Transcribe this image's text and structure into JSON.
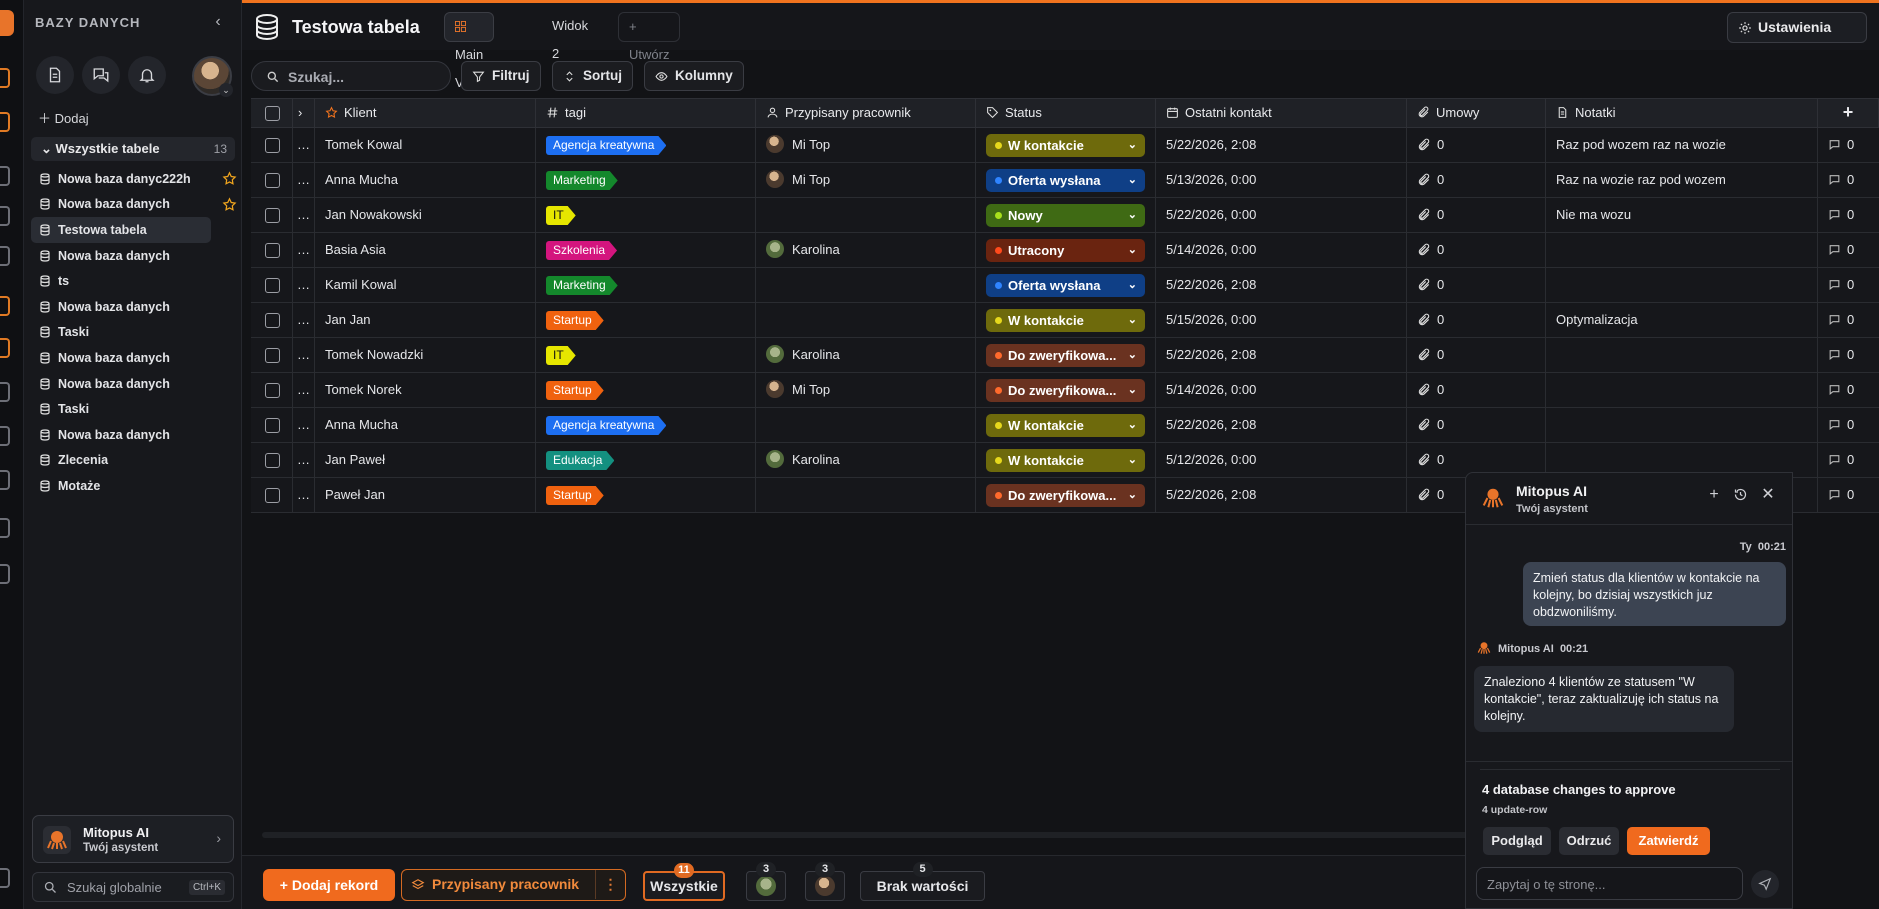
{
  "sidebar": {
    "title": "BAZY DANYCH",
    "add_label": "Dodaj",
    "all_tables_label": "Wszystkie tabele",
    "all_tables_count": "13",
    "tables": [
      {
        "label": "Nowa baza danyc222h",
        "starred": true,
        "active": false
      },
      {
        "label": "Nowa baza danych",
        "starred": true,
        "active": false
      },
      {
        "label": "Testowa tabela",
        "starred": false,
        "active": true
      },
      {
        "label": "Nowa baza danych",
        "starred": false,
        "active": false
      },
      {
        "label": "ts",
        "starred": false,
        "active": false
      },
      {
        "label": "Nowa baza danych",
        "starred": false,
        "active": false
      },
      {
        "label": "Taski",
        "starred": false,
        "active": false
      },
      {
        "label": "Nowa baza danych",
        "starred": false,
        "active": false
      },
      {
        "label": "Nowa baza danych",
        "starred": false,
        "active": false
      },
      {
        "label": "Taski",
        "starred": false,
        "active": false
      },
      {
        "label": "Nowa baza danych",
        "starred": false,
        "active": false
      },
      {
        "label": "Zlecenia",
        "starred": false,
        "active": false
      },
      {
        "label": "Motaże",
        "starred": false,
        "active": false
      }
    ],
    "ai_card": {
      "title": "Mitopus AI",
      "subtitle": "Twój asystent"
    },
    "global_search": {
      "placeholder": "Szukaj globalnie",
      "shortcut": "Ctrl+K"
    }
  },
  "topbar": {
    "title": "Testowa tabela",
    "views": [
      "Main View",
      "Widok 2"
    ],
    "create_label": "+ Utwórz",
    "settings_label": "Ustawienia"
  },
  "toolbar": {
    "search_placeholder": "Szukaj...",
    "filter_label": "Filtruj",
    "sort_label": "Sortuj",
    "columns_label": "Kolumny"
  },
  "table": {
    "columns": [
      "Klient",
      "tagi",
      "Przypisany pracownik",
      "Status",
      "Ostatni kontakt",
      "Umowy",
      "Notatki"
    ],
    "rows": [
      {
        "client": "Tomek Kowal",
        "tag": "Agencja kreatywna",
        "tag_color": "#1d6ff2",
        "worker": "Mi Top",
        "worker_type": "mitop",
        "status": "W kontakcie",
        "status_key": "kontakt",
        "date": "5/22/2026, 2:08",
        "contracts": "0",
        "notes": "Raz pod wozem raz na wozie",
        "comments": "0"
      },
      {
        "client": "Anna Mucha",
        "tag": "Marketing",
        "tag_color": "#14882c",
        "worker": "Mi Top",
        "worker_type": "mitop",
        "status": "Oferta wysłana",
        "status_key": "oferta",
        "date": "5/13/2026, 0:00",
        "contracts": "0",
        "notes": "Raz na wozie raz pod wozem",
        "comments": "0"
      },
      {
        "client": "Jan Nowakowski",
        "tag": "IT",
        "tag_color": "#e6e600",
        "tag_text": "#111111",
        "worker": "",
        "worker_type": "",
        "status": "Nowy",
        "status_key": "nowy",
        "date": "5/22/2026, 0:00",
        "contracts": "0",
        "notes": "Nie ma wozu",
        "comments": "0"
      },
      {
        "client": "Basia Asia",
        "tag": "Szkolenia",
        "tag_color": "#d4157e",
        "worker": "Karolina",
        "worker_type": "karolina",
        "status": "Utracony",
        "status_key": "utracony",
        "date": "5/14/2026, 0:00",
        "contracts": "0",
        "notes": "",
        "comments": "0"
      },
      {
        "client": "Kamil Kowal",
        "tag": "Marketing",
        "tag_color": "#14882c",
        "worker": "",
        "worker_type": "",
        "status": "Oferta wysłana",
        "status_key": "oferta",
        "date": "5/22/2026, 2:08",
        "contracts": "0",
        "notes": "",
        "comments": "0"
      },
      {
        "client": "Jan Jan",
        "tag": "Startup",
        "tag_color": "#f0620f",
        "worker": "",
        "worker_type": "",
        "status": "W kontakcie",
        "status_key": "kontakt",
        "date": "5/15/2026, 0:00",
        "contracts": "0",
        "notes": "Optymalizacja",
        "comments": "0"
      },
      {
        "client": "Tomek Nowadzki",
        "tag": "IT",
        "tag_color": "#e6e600",
        "tag_text": "#111111",
        "worker": "Karolina",
        "worker_type": "karolina",
        "status": "Do zweryfikowa...",
        "status_key": "zweryf",
        "date": "5/22/2026, 2:08",
        "contracts": "0",
        "notes": "",
        "comments": "0"
      },
      {
        "client": "Tomek Norek",
        "tag": "Startup",
        "tag_color": "#f0620f",
        "worker": "Mi Top",
        "worker_type": "mitop",
        "status": "Do zweryfikowa...",
        "status_key": "zweryf",
        "date": "5/14/2026, 0:00",
        "contracts": "0",
        "notes": "",
        "comments": "0"
      },
      {
        "client": "Anna Mucha",
        "tag": "Agencja kreatywna",
        "tag_color": "#1d6ff2",
        "worker": "",
        "worker_type": "",
        "status": "W kontakcie",
        "status_key": "kontakt",
        "date": "5/22/2026, 2:08",
        "contracts": "0",
        "notes": "",
        "comments": "0"
      },
      {
        "client": "Jan Paweł",
        "tag": "Edukacja",
        "tag_color": "#149080",
        "worker": "Karolina",
        "worker_type": "karolina",
        "status": "W kontakcie",
        "status_key": "kontakt",
        "date": "5/12/2026, 0:00",
        "contracts": "0",
        "notes": "",
        "comments": "0"
      },
      {
        "client": "Paweł Jan",
        "tag": "Startup",
        "tag_color": "#f0620f",
        "worker": "",
        "worker_type": "",
        "status": "Do zweryfikowa...",
        "status_key": "zweryf",
        "date": "5/22/2026, 2:08",
        "contracts": "0",
        "notes": "",
        "comments": "0"
      }
    ]
  },
  "status_styles": {
    "kontakt": {
      "bg": "#6e6a0c",
      "dot": "#e6d81c"
    },
    "oferta": {
      "bg": "#0f3f86",
      "dot": "#2f84ff"
    },
    "nowy": {
      "bg": "#3f6a14",
      "dot": "#a8e01c"
    },
    "utracony": {
      "bg": "#6a2410",
      "dot": "#ff4a1c"
    },
    "zweryf": {
      "bg": "#6a3220",
      "dot": "#ff6a2c"
    }
  },
  "bottombar": {
    "add_record_label": "+ Dodaj rekord",
    "group_label": "Przypisany pracownik",
    "filters": [
      {
        "label": "Wszystkie",
        "count": "11",
        "active": true
      },
      {
        "label": "",
        "count": "3",
        "avatar": "karolina"
      },
      {
        "label": "",
        "count": "3",
        "avatar": "mitop"
      },
      {
        "label": "Brak wartości",
        "count": "5"
      }
    ]
  },
  "ai_panel": {
    "title": "Mitopus AI",
    "subtitle": "Twój asystent",
    "user_name": "Ty",
    "user_time": "00:21",
    "user_message": "Zmień status dla klientów w kontakcie na kolejny, bo dzisiaj wszystkich juz obdzwoniliśmy.",
    "ai_name": "Mitopus AI",
    "ai_time": "00:21",
    "ai_message": "Znaleziono 4 klientów ze statusem \"W kontakcie\", teraz zaktualizuję ich status na kolejny.",
    "changes_title": "4 database changes to approve",
    "changes_sub": "4 update-row",
    "btn_preview": "Podgląd",
    "btn_reject": "Odrzuć",
    "btn_approve": "Zatwierdź",
    "input_placeholder": "Zapytaj o tę stronę..."
  }
}
